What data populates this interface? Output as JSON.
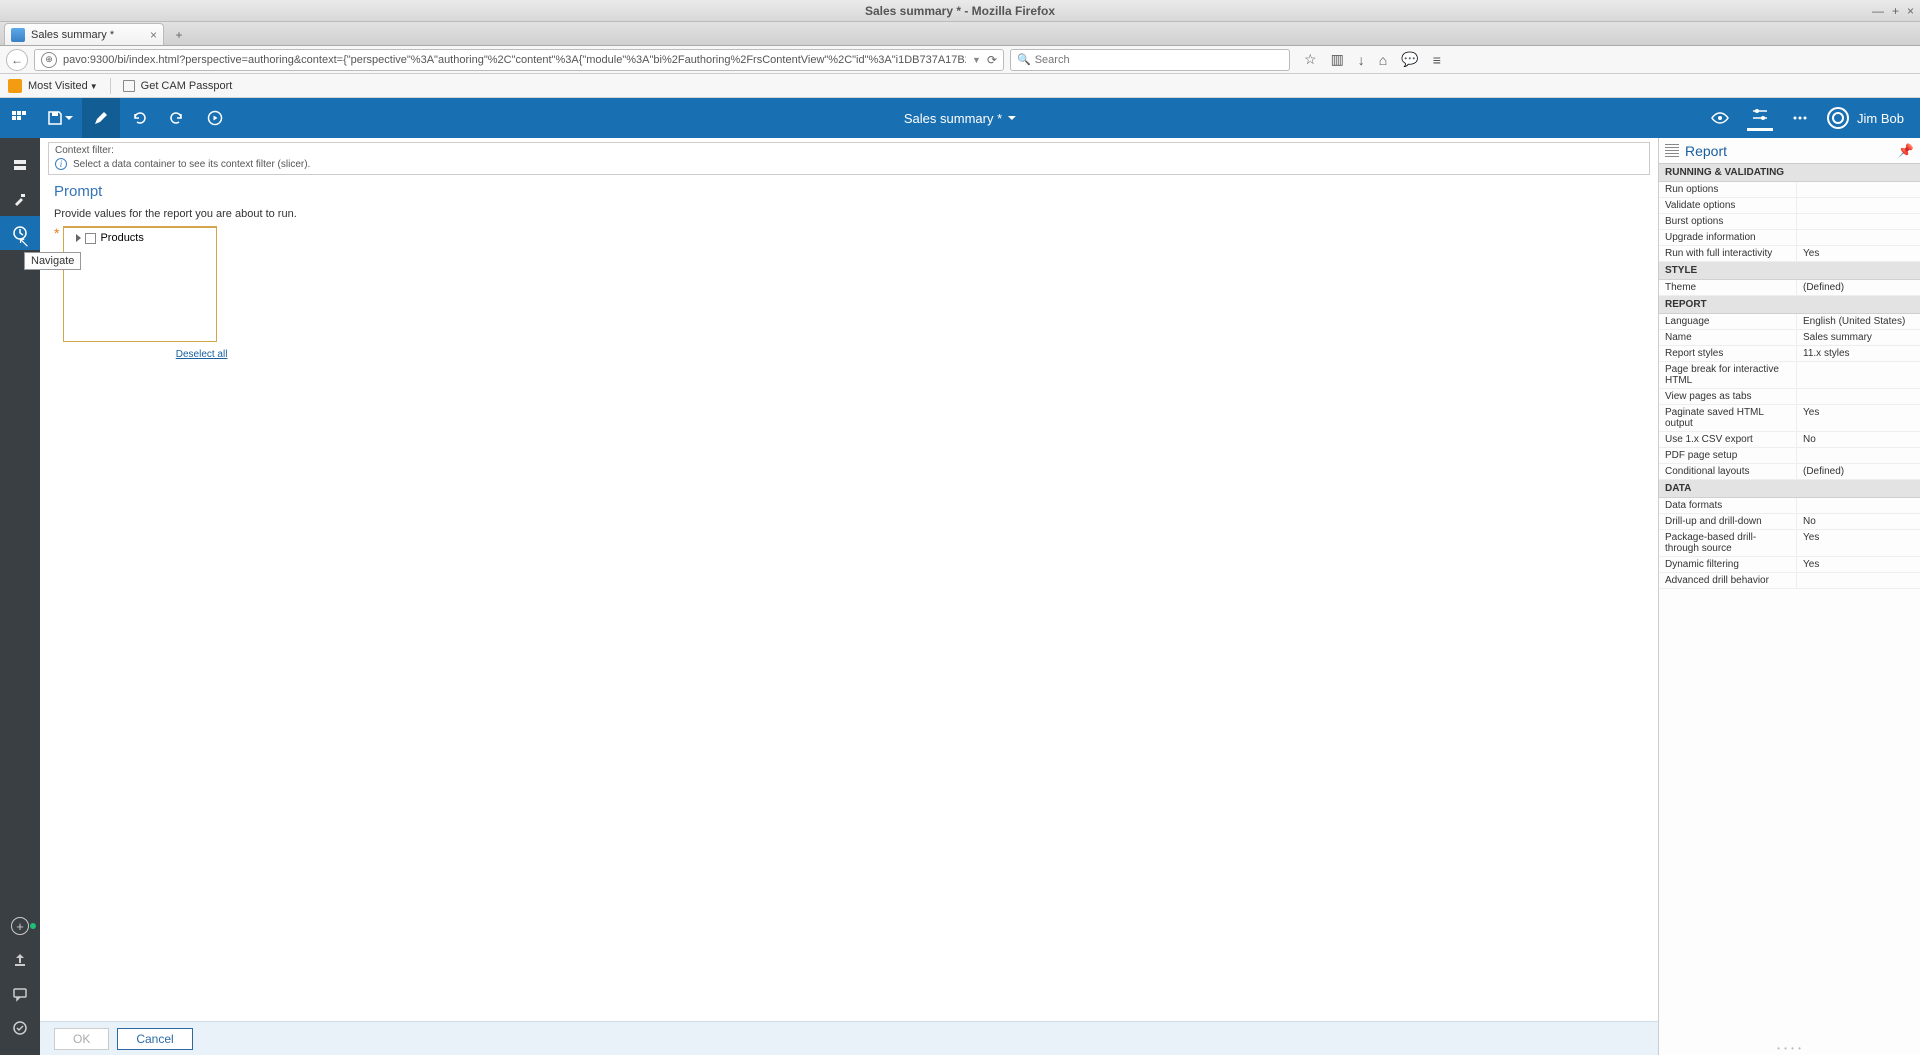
{
  "window": {
    "title": "Sales summary * - Mozilla Firefox",
    "min": "—",
    "max": "+",
    "close": "×"
  },
  "browser_tab": {
    "label": "Sales summary *"
  },
  "url": "pavo:9300/bi/index.html?perspective=authoring&context={\"perspective\"%3A\"authoring\"%2C\"content\"%3A{\"module\"%3A\"bi%2Fauthoring%2FrsContentView\"%2C\"id\"%3A\"i1DB737A17B2C4E02A56404FCA6BEA1DA\"%20",
  "search_placeholder": "Search",
  "bookmarks": {
    "most_visited": "Most Visited",
    "cam": "Get CAM Passport"
  },
  "app": {
    "doc_title": "Sales summary *",
    "user": "Jim Bob"
  },
  "tooltip": {
    "navigate": "Navigate"
  },
  "context_filter": {
    "label": "Context filter:",
    "msg": "Select a data container to see its context filter (slicer)."
  },
  "prompt": {
    "heading": "Prompt",
    "desc": "Provide values for the report you are about to run.",
    "tree_item": "Products",
    "deselect": "Deselect all"
  },
  "buttons": {
    "ok": "OK",
    "cancel": "Cancel"
  },
  "properties": {
    "panel_title": "Report",
    "sections": {
      "running": "RUNNING & VALIDATING",
      "style": "STYLE",
      "report": "REPORT",
      "data": "DATA"
    },
    "running": {
      "run_options": "Run options",
      "validate_options": "Validate options",
      "burst_options": "Burst options",
      "upgrade_info": "Upgrade information",
      "run_full_interactivity": "Run with full interactivity",
      "run_full_interactivity_v": "Yes"
    },
    "style": {
      "theme": "Theme",
      "theme_v": "(Defined)"
    },
    "report": {
      "language": "Language",
      "language_v": "English (United States)",
      "name": "Name",
      "name_v": "Sales summary",
      "styles": "Report styles",
      "styles_v": "11.x styles",
      "page_break": "Page break for interactive HTML",
      "view_tabs": "View pages as tabs",
      "paginate": "Paginate saved HTML output",
      "paginate_v": "Yes",
      "csv": "Use 1.x CSV export",
      "csv_v": "No",
      "pdf": "PDF page setup",
      "cond_layouts": "Conditional layouts",
      "cond_layouts_v": "(Defined)"
    },
    "data": {
      "formats": "Data formats",
      "drill": "Drill-up and drill-down",
      "drill_v": "No",
      "pkg_drill": "Package-based drill-through source",
      "pkg_drill_v": "Yes",
      "dyn_filter": "Dynamic filtering",
      "dyn_filter_v": "Yes",
      "adv_drill": "Advanced drill behavior"
    }
  }
}
